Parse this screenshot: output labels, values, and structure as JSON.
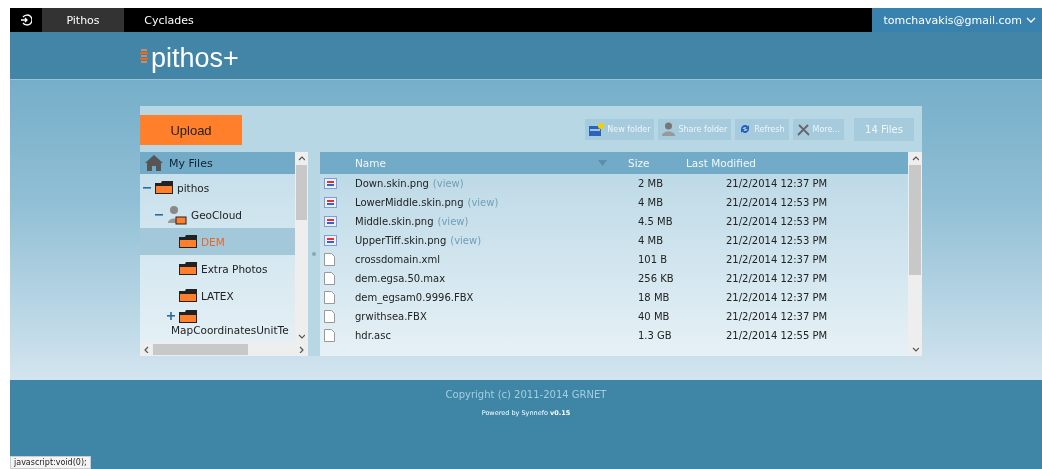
{
  "top_bar": {
    "tabs": [
      {
        "label": "Pithos",
        "selected": true
      },
      {
        "label": "Cyclades",
        "selected": false
      }
    ],
    "account": "tomchavakis@gmail.com"
  },
  "logo": "pithos+",
  "upload_button": "Upload",
  "toolbar": [
    {
      "label": "New folder",
      "kind": "new-folder"
    },
    {
      "label": "Share folder",
      "kind": "share"
    },
    {
      "label": "Refresh",
      "kind": "refresh"
    },
    {
      "label": "More...",
      "kind": "tools"
    }
  ],
  "file_count": "14 Files",
  "tree": {
    "root": "My Files",
    "items": [
      {
        "label": "pithos",
        "kind": "folder",
        "expanded": true,
        "selected": false,
        "children": [
          {
            "label": "GeoCloud",
            "kind": "shared",
            "expanded": true,
            "selected": false,
            "children": [
              {
                "label": "DEM",
                "kind": "folder",
                "selected": true
              },
              {
                "label": "Extra Photos",
                "kind": "folder",
                "selected": false
              },
              {
                "label": "LATEX",
                "kind": "folder",
                "selected": false
              },
              {
                "label": "MapCoordinatesUnitTe",
                "kind": "folder",
                "expanded": false,
                "selected": false
              }
            ]
          }
        ]
      }
    ]
  },
  "table": {
    "columns": [
      "Name",
      "Size",
      "Last Modified"
    ],
    "rows": [
      {
        "name": "Down.skin.png",
        "kind": "image",
        "link": "(view)",
        "size": "2 MB",
        "modified": "21/2/2014 12:37 PM"
      },
      {
        "name": "LowerMiddle.skin.png",
        "kind": "image",
        "link": "(view)",
        "size": "4 MB",
        "modified": "21/2/2014 12:53 PM"
      },
      {
        "name": "Middle.skin.png",
        "kind": "image",
        "link": "(view)",
        "size": "4.5 MB",
        "modified": "21/2/2014 12:53 PM"
      },
      {
        "name": "UpperTiff.skin.png",
        "kind": "image",
        "link": "(view)",
        "size": "4 MB",
        "modified": "21/2/2014 12:53 PM"
      },
      {
        "name": "crossdomain.xml",
        "kind": "file",
        "size": "101 B",
        "modified": "21/2/2014 12:37 PM"
      },
      {
        "name": "dem.egsa.50.max",
        "kind": "file",
        "size": "256 KB",
        "modified": "21/2/2014 12:37 PM"
      },
      {
        "name": "dem_egsam0.9996.FBX",
        "kind": "file",
        "size": "18 MB",
        "modified": "21/2/2014 12:37 PM"
      },
      {
        "name": "grwithsea.FBX",
        "kind": "file",
        "size": "40 MB",
        "modified": "21/2/2014 12:37 PM"
      },
      {
        "name": "hdr.asc",
        "kind": "file",
        "size": "1.3 GB",
        "modified": "21/2/2014 12:55 PM"
      }
    ]
  },
  "footer": {
    "copyright": "Copyright (c) 2011-2014 GRNET",
    "powered": "Powered by Synnefo **v0.15**"
  },
  "status_bar": "javascript:void(0);"
}
